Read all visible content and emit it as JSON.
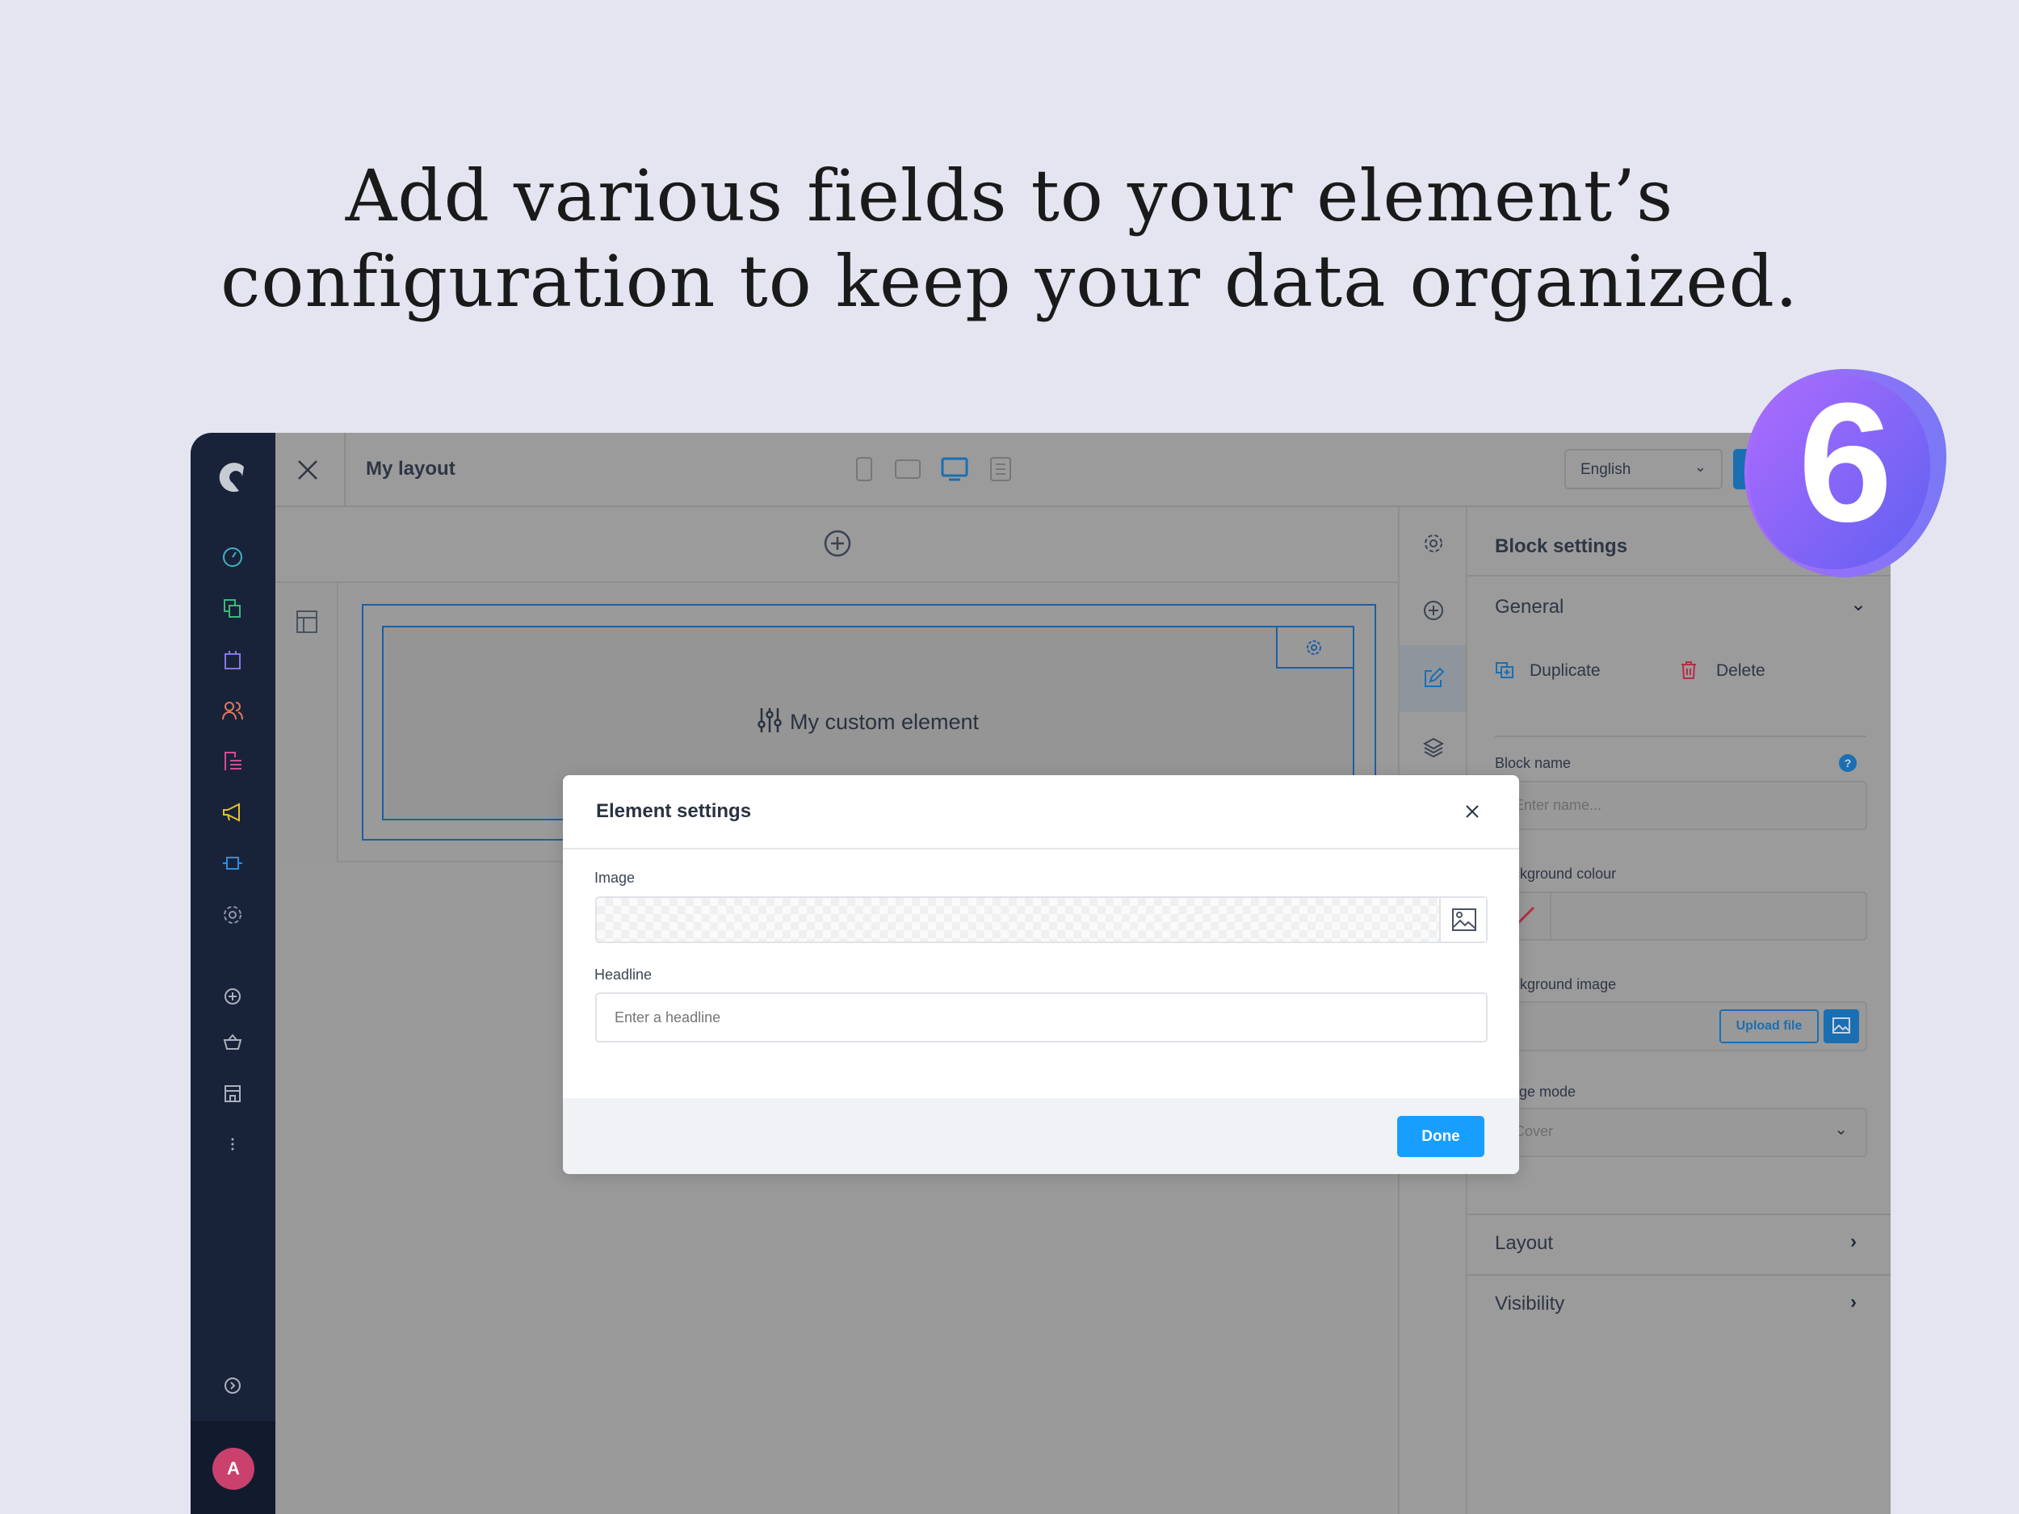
{
  "headline": {
    "line1": "Add various fields to your element’s",
    "line2": "configuration to keep your data organized."
  },
  "badge": {
    "text": "6",
    "colors": [
      "#a56bff",
      "#5b5cf0"
    ]
  },
  "topbar": {
    "title": "My layout",
    "language": "English",
    "devices": [
      "mobile",
      "tablet",
      "desktop",
      "list"
    ],
    "active_device": "desktop"
  },
  "canvas": {
    "element_label": "My custom element"
  },
  "block_settings": {
    "title": "Block settings",
    "general": "General",
    "duplicate": "Duplicate",
    "delete": "Delete",
    "block_name_label": "Block name",
    "block_name_placeholder": "Enter name...",
    "bg_colour_label": "Background colour",
    "bg_image_label": "Background image",
    "upload_file": "Upload file",
    "image_mode_label": "Image mode",
    "image_mode_value": "Cover",
    "layout": "Layout",
    "visibility": "Visibility"
  },
  "modal": {
    "title": "Element settings",
    "image_label": "Image",
    "headline_label": "Headline",
    "headline_placeholder": "Enter a headline",
    "done": "Done"
  },
  "user": {
    "avatar": "A"
  },
  "colors": {
    "accent": "#189eff",
    "sidebar": "#18233a",
    "avatar": "#c9416c"
  }
}
